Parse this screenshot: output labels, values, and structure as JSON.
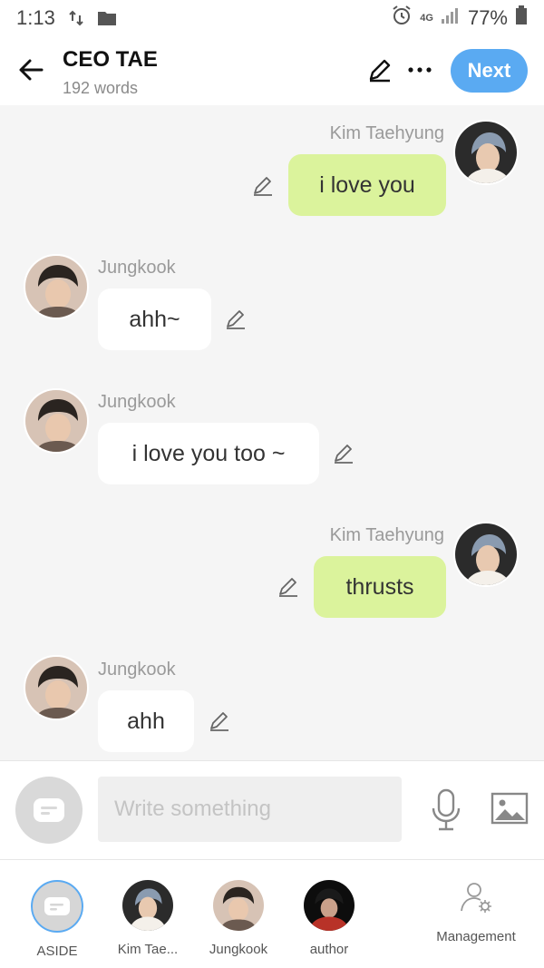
{
  "status_bar": {
    "time": "1:13",
    "network": "4G",
    "battery": "77%"
  },
  "header": {
    "title": "CEO TAE",
    "subtitle": "192 words",
    "next_label": "Next"
  },
  "messages": [
    {
      "side": "right",
      "sender": "Kim Taehyung",
      "text": "i love you"
    },
    {
      "side": "left",
      "sender": "Jungkook",
      "text": "ahh~"
    },
    {
      "side": "left",
      "sender": "Jungkook",
      "text": "i love you too ~"
    },
    {
      "side": "right",
      "sender": "Kim Taehyung",
      "text": "thrusts"
    },
    {
      "side": "left",
      "sender": "Jungkook",
      "text": "ahh"
    }
  ],
  "composer": {
    "placeholder": "Write something"
  },
  "bottom_tabs": [
    {
      "label": "ASIDE"
    },
    {
      "label": "Kim Tae..."
    },
    {
      "label": "Jungkook"
    },
    {
      "label": "author"
    },
    {
      "label": "Management"
    }
  ],
  "colors": {
    "accent": "#5aaaf2",
    "right_bubble": "#dbf39c",
    "left_bubble": "#ffffff",
    "background": "#f5f5f5"
  }
}
